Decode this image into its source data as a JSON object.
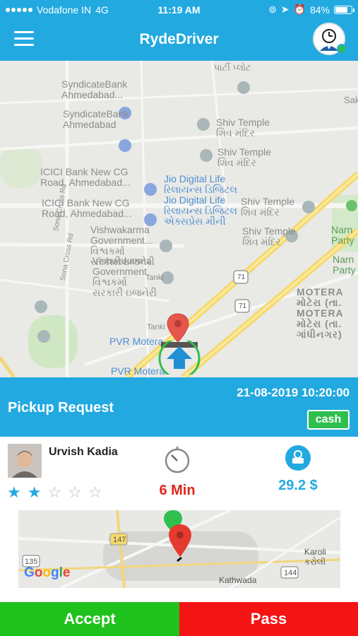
{
  "status_bar": {
    "carrier": "Vodafone IN",
    "network": "4G",
    "time": "11:19 AM",
    "battery_percent": 84,
    "battery_label": "84%"
  },
  "header": {
    "title": "RydeDriver",
    "menu_icon": "hamburger-icon",
    "avatar_icon": "driver-avatar-icon",
    "online": true
  },
  "map": {
    "labels": [
      "SyndicateBank\nAhmedabad...",
      "SyndicateBank\nAhmedabad",
      "Shiv Temple\nશિવ મંદિર",
      "Shiv Temple\nશિવ મંદિર",
      "ICICI Bank New CG\nRoad, Ahmedabad...",
      "ICICI Bank New CG\nRoad, Ahmedabad...",
      "Jio Digital Life\nરિલાયન્સ ડિજિટલ\nJio Digital Life\nરિલાયન્સ ડિજિટલ\nએક્સપ્રેસ મીની",
      "Shiv Temple\nશિવ મંદિર",
      "Shiv Temple\nશિવ મંદિર",
      "Vishwakarma\nGovernment...\nવિશ્વકર્મા\nસરકારી ઇજનેરી",
      "Vishwakarma\nGovernment\nવિશ્વકર્મા\nસરકારી ઇજનેરી",
      "MOTERA\nમોટેરા (તા.\nMOTERA\nમોટેરા (તા.\nગાંધીનગર)",
      "PVR Motera",
      "PVR Motera",
      "Tanki",
      "Tanki",
      "Narn\nParty",
      "Narn\nParty",
      "Sona Cross Rd",
      "Sona Cross Rd",
      "પાર્ટી પ્લોટ",
      "Saka"
    ],
    "highway_shields": [
      "71",
      "71"
    ],
    "pickup_pin_color": "#e5574c",
    "driver_marker_color": "#2fbf4f"
  },
  "pickup": {
    "title": "Pickup Request",
    "datetime": "21-08-2019 10:20:00",
    "payment": "cash"
  },
  "rider": {
    "name": "Urvish Kadia",
    "rating": 2,
    "rating_max": 5,
    "photo_icon": "rider-photo"
  },
  "trip": {
    "time_label": "6 Min",
    "time_icon": "timer-icon",
    "fare_label": "29.2 $",
    "fare_icon": "fare-money-icon"
  },
  "mini_map": {
    "labels": [
      "147",
      "135",
      "Karoli\nકરોલી",
      "144",
      "Kathwada"
    ],
    "logo": "Google"
  },
  "actions": {
    "accept_label": "Accept",
    "pass_label": "Pass"
  },
  "colors": {
    "primary": "#22a9e0",
    "accept": "#1fc21d",
    "pass": "#f51414",
    "time": "#e2231a",
    "cash_badge": "#2fbf4f"
  }
}
